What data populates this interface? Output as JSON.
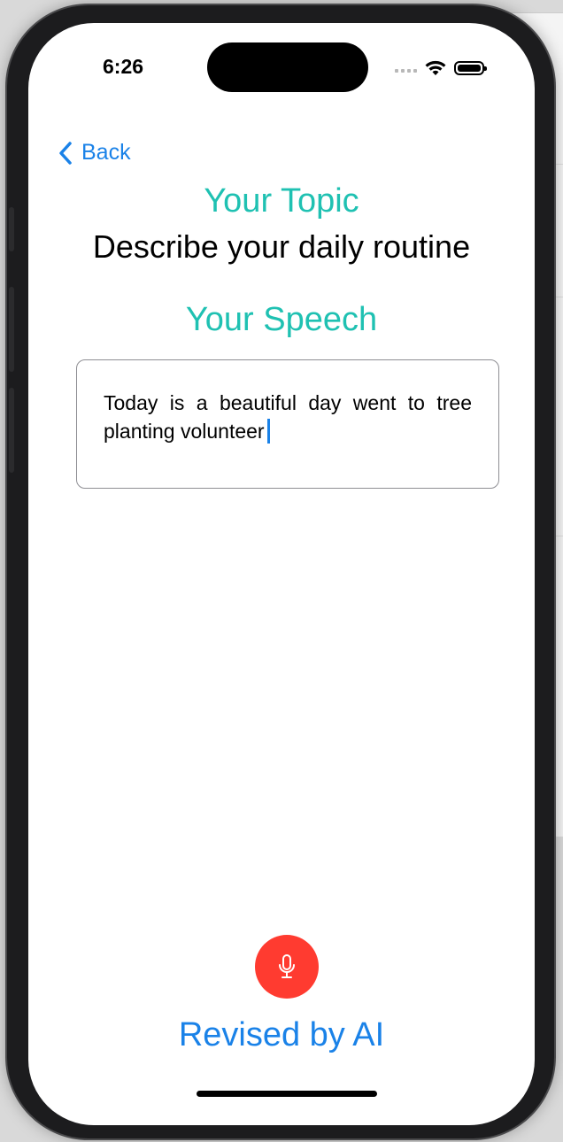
{
  "status_bar": {
    "time": "6:26"
  },
  "nav": {
    "back_label": "Back"
  },
  "topic": {
    "label": "Your Topic",
    "text": "Describe your daily routine"
  },
  "speech": {
    "label": "Your Speech",
    "input_value": "Today is a beautiful day went to tree planting volunteer"
  },
  "actions": {
    "mic_icon": "microphone-icon",
    "revised_label": "Revised by AI"
  },
  "colors": {
    "accent_teal": "#1fc1b2",
    "link_blue": "#1a82e8",
    "mic_red": "#ff3b30"
  }
}
